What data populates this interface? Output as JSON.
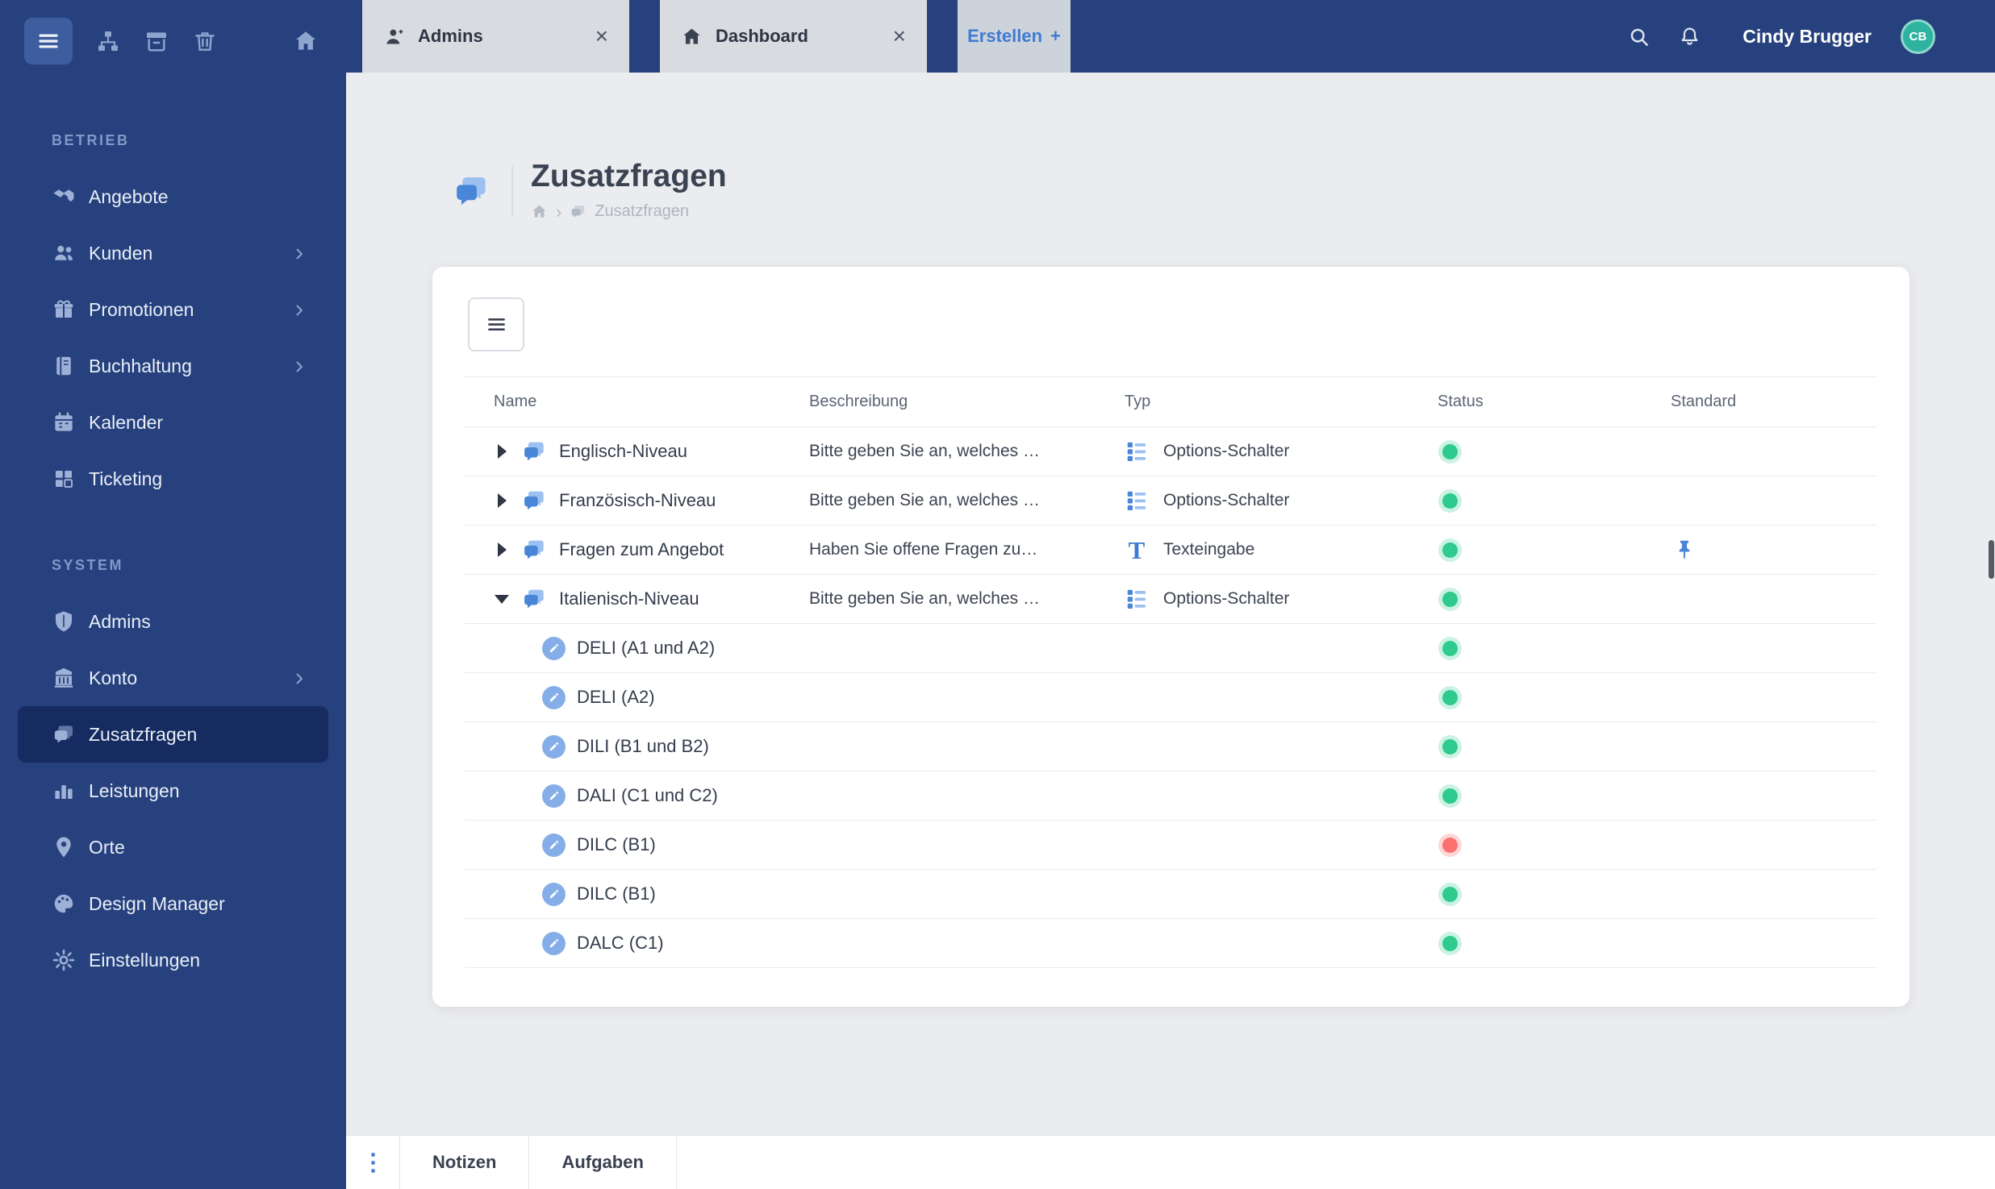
{
  "icons": {
    "close": "×",
    "plus": "+",
    "breadcrumb_separator": "›",
    "text_type_glyph": "T"
  },
  "sidebar": {
    "sections": [
      {
        "label": "BETRIEB",
        "items": [
          {
            "label": "Angebote",
            "icon": "handshake",
            "has_submenu": false
          },
          {
            "label": "Kunden",
            "icon": "users",
            "has_submenu": true
          },
          {
            "label": "Promotionen",
            "icon": "gift",
            "has_submenu": true
          },
          {
            "label": "Buchhaltung",
            "icon": "book",
            "has_submenu": true
          },
          {
            "label": "Kalender",
            "icon": "calendar",
            "has_submenu": false
          },
          {
            "label": "Ticketing",
            "icon": "grid",
            "has_submenu": false
          }
        ]
      },
      {
        "label": "SYSTEM",
        "items": [
          {
            "label": "Admins",
            "icon": "shield",
            "has_submenu": false
          },
          {
            "label": "Konto",
            "icon": "bank",
            "has_submenu": true
          },
          {
            "label": "Zusatzfragen",
            "icon": "chat-bubbles",
            "has_submenu": false,
            "active": true
          },
          {
            "label": "Leistungen",
            "icon": "bar-chart",
            "has_submenu": false
          },
          {
            "label": "Orte",
            "icon": "map-pin",
            "has_submenu": false
          },
          {
            "label": "Design Manager",
            "icon": "palette",
            "has_submenu": false
          },
          {
            "label": "Einstellungen",
            "icon": "gear",
            "has_submenu": false
          }
        ]
      }
    ]
  },
  "topbar": {
    "tabs": [
      {
        "label": "Admins",
        "icon": "user"
      },
      {
        "label": "Dashboard",
        "icon": "home"
      }
    ],
    "create_label": "Erstellen",
    "user": {
      "name": "Cindy Brugger",
      "initials": "CB"
    }
  },
  "page": {
    "title": "Zusatzfragen",
    "breadcrumb_current": "Zusatzfragen"
  },
  "table": {
    "columns": [
      "Name",
      "Beschreibung",
      "Typ",
      "Status",
      "Standard"
    ],
    "rows": [
      {
        "name": "Englisch-Niveau",
        "description": "Bitte geben Sie an, welches …",
        "type": "Options-Schalter",
        "status": "green",
        "standard": false,
        "expanded": false
      },
      {
        "name": "Französisch-Niveau",
        "description": "Bitte geben Sie an, welches …",
        "type": "Options-Schalter",
        "status": "green",
        "standard": false,
        "expanded": false
      },
      {
        "name": "Fragen zum Angebot",
        "description": "Haben Sie offene Fragen zu…",
        "type": "Texteingabe",
        "status": "green",
        "standard": true,
        "expanded": false
      },
      {
        "name": "Italienisch-Niveau",
        "description": "Bitte geben Sie an, welches …",
        "type": "Options-Schalter",
        "status": "green",
        "standard": false,
        "expanded": true
      },
      {
        "name": "DELI (A1 und A2)",
        "status": "green",
        "child": true
      },
      {
        "name": "DELI (A2)",
        "status": "green",
        "child": true
      },
      {
        "name": "DILI (B1 und B2)",
        "status": "green",
        "child": true
      },
      {
        "name": "DALI (C1 und C2)",
        "status": "green",
        "child": true
      },
      {
        "name": "DILC (B1)",
        "status": "red",
        "child": true
      },
      {
        "name": "DILC (B1)",
        "status": "green",
        "child": true
      },
      {
        "name": "DALC (C1)",
        "status": "green",
        "child": true
      }
    ]
  },
  "footer": {
    "tabs": [
      "Notizen",
      "Aufgaben"
    ]
  },
  "colors": {
    "accent_blue": "#4a86d8",
    "status_active": "#2fcb8e",
    "status_inactive": "#fc7070",
    "sidebar_bg": "#26417d",
    "avatar_bg": "#2db3a0"
  }
}
